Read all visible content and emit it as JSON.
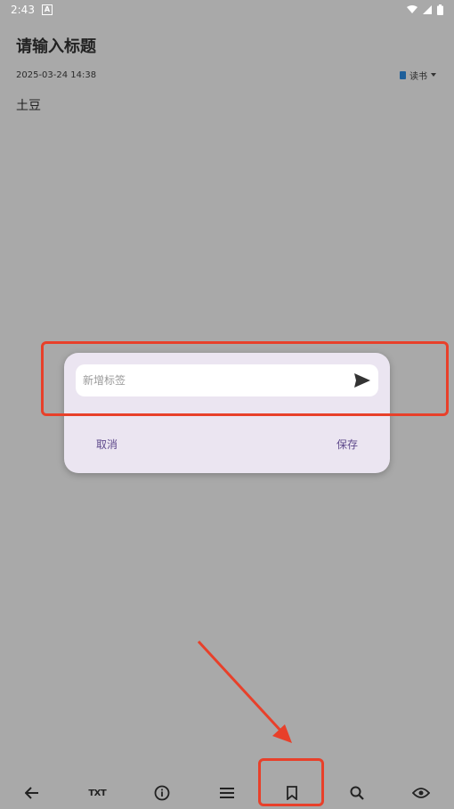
{
  "status_bar": {
    "time": "2:43",
    "notification_icon": "a-box-icon",
    "icons": [
      "wifi-icon",
      "signal-icon",
      "battery-icon"
    ]
  },
  "note": {
    "title": "请输入标题",
    "datetime": "2025-03-24 14:38",
    "category": "读书",
    "content": "土豆"
  },
  "dialog": {
    "input_placeholder": "新增标签",
    "input_value": "",
    "send_icon": "send-icon",
    "cancel_label": "取消",
    "save_label": "保存"
  },
  "toolbar": {
    "txt_label": "TXT",
    "items": [
      "back-arrow-icon",
      "txt-icon",
      "info-icon",
      "menu-icon",
      "bookmark-icon",
      "search-icon",
      "eye-icon"
    ]
  },
  "colors": {
    "accent": "#5f4a8c",
    "annotation": "#e8402a",
    "scrim_background": "#a9a9a9",
    "dialog_background": "#ebe5f1"
  }
}
